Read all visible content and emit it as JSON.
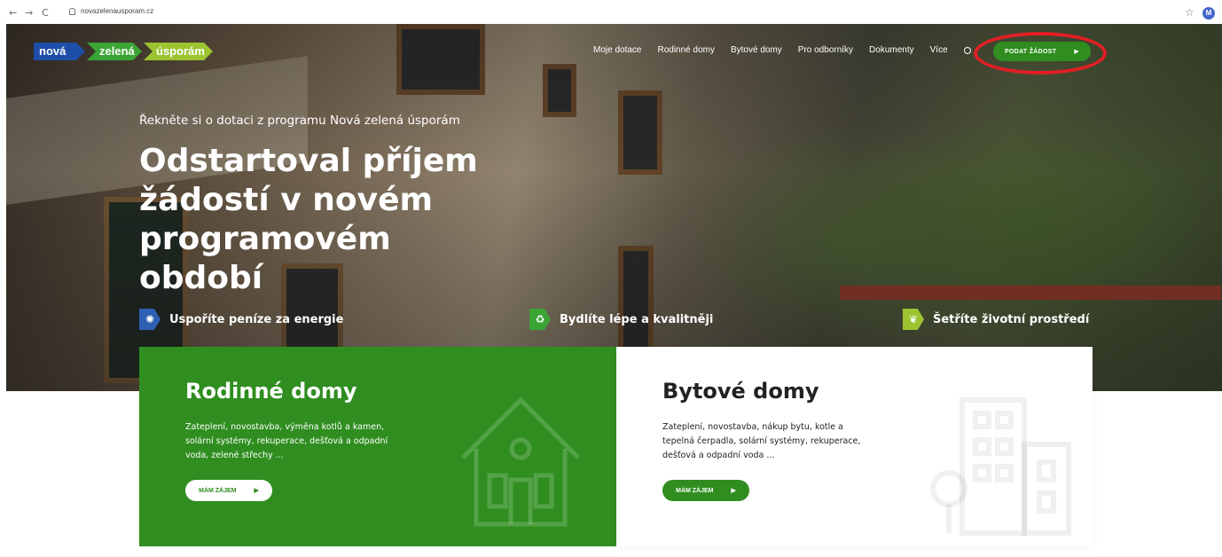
{
  "browser": {
    "back": "←",
    "forward": "→",
    "reload": "C",
    "url": "novazelenausporam.cz",
    "profile_initial": "M"
  },
  "logo": {
    "part1": "nová",
    "part2": "zelená",
    "part3": "úsporám",
    "colors": {
      "part1": "#1e4fa8",
      "part2": "#3aa535",
      "part3": "#9cc431"
    }
  },
  "nav": {
    "items": [
      "Moje dotace",
      "Rodinné domy",
      "Bytové domy",
      "Pro odborníky",
      "Dokumenty",
      "Více"
    ],
    "cta_label": "PODAT ŽÁDOST"
  },
  "hero": {
    "kicker": "Řekněte si o dotaci z programu Nová zelená úsporám",
    "headline": "Odstartoval příjem žádostí v novém programovém období"
  },
  "features": [
    {
      "label": "Uspoříte peníze za energie",
      "icon": "lightbulb-icon",
      "color": "#2f5fb3"
    },
    {
      "label": "Bydlíte lépe a kvalitněji",
      "icon": "recycle-icon",
      "color": "#3aa535"
    },
    {
      "label": "Šetříte životní prostředí",
      "icon": "leaf-icon",
      "color": "#9cc431"
    }
  ],
  "cards": {
    "family": {
      "title": "Rodinné domy",
      "description": "Zateplení, novostavba, výměna kotlů a kamen, solární systémy, rekuperace, dešťová a odpadní voda, zelené střechy ...",
      "button": "MÁM ZÁJEM"
    },
    "apartment": {
      "title": "Bytové domy",
      "description": "Zateplení, novostavba, nákup bytu, kotle a tepelná čerpadla, solární systémy, rekuperace, dešťová a odpadní voda ...",
      "button": "MÁM ZÁJEM"
    }
  },
  "colors": {
    "brand_green": "#2f8e1f",
    "highlight": "#e31e24"
  }
}
